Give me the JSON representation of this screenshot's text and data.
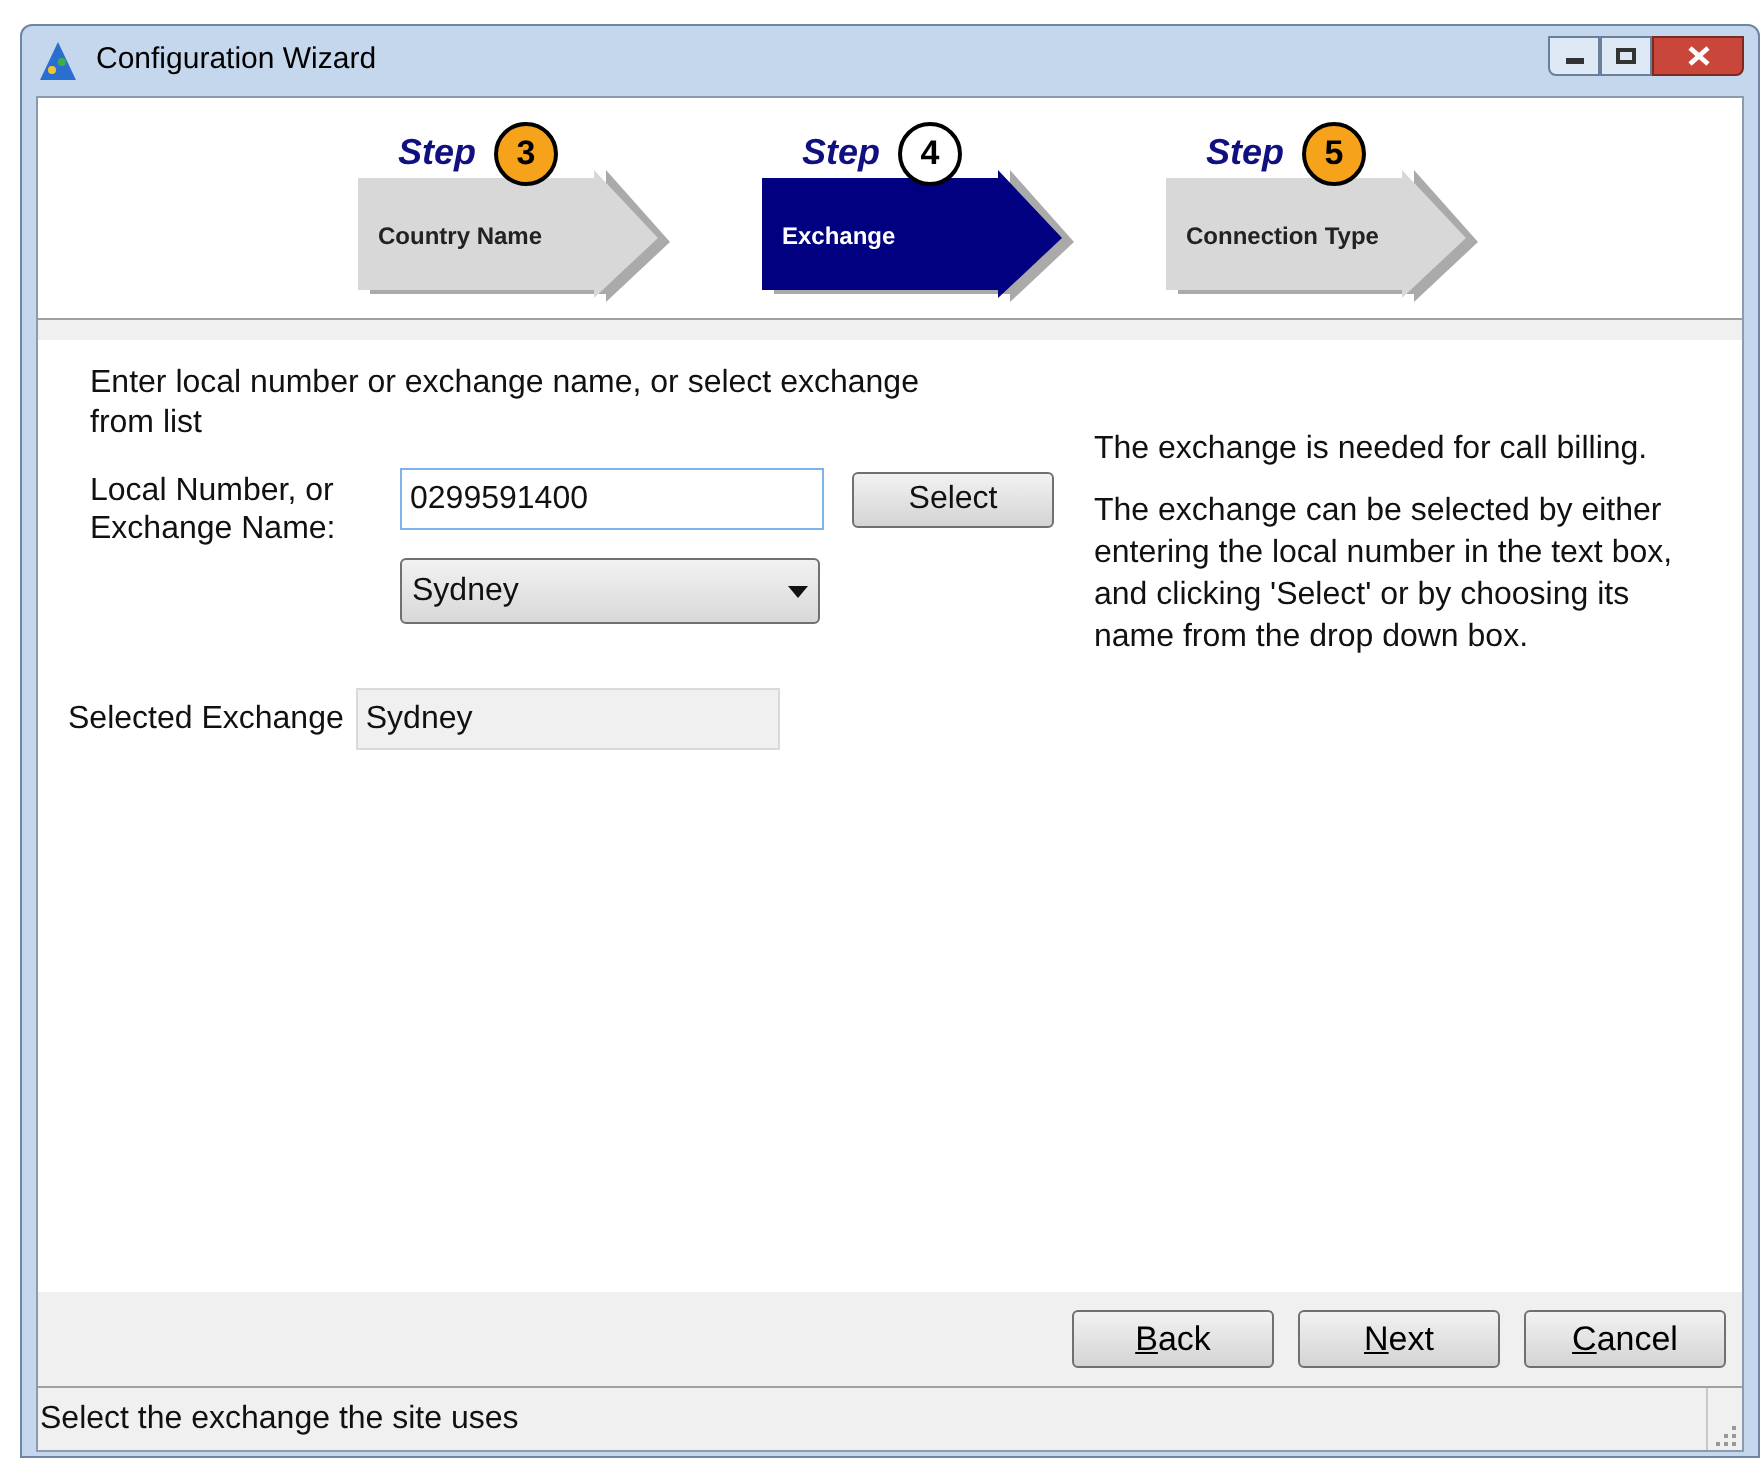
{
  "window": {
    "title": "Configuration Wizard"
  },
  "steps": [
    {
      "word": "Step",
      "number": "3",
      "label": "Country Name",
      "selected": false
    },
    {
      "word": "Step",
      "number": "4",
      "label": "Exchange",
      "selected": true
    },
    {
      "word": "Step",
      "number": "5",
      "label": "Connection Type",
      "selected": false
    }
  ],
  "form": {
    "instruction": "Enter local number or exchange name, or select exchange from list",
    "number_label": "Local Number, or Exchange Name:",
    "number_value": "0299591400",
    "select_button": "Select",
    "exchange_dropdown": "Sydney",
    "selected_label": "Selected Exchange",
    "selected_value": "Sydney"
  },
  "help": [
    "The exchange is needed for call billing.",
    "The exchange can be selected by either entering the local number in the text box, and clicking 'Select' or by choosing its name from the drop down box."
  ],
  "buttons": [
    {
      "accel": "B",
      "rest": "ack"
    },
    {
      "accel": "N",
      "rest": "ext"
    },
    {
      "accel": "C",
      "rest": "ancel"
    }
  ],
  "status_bar": "Select the exchange the site uses"
}
